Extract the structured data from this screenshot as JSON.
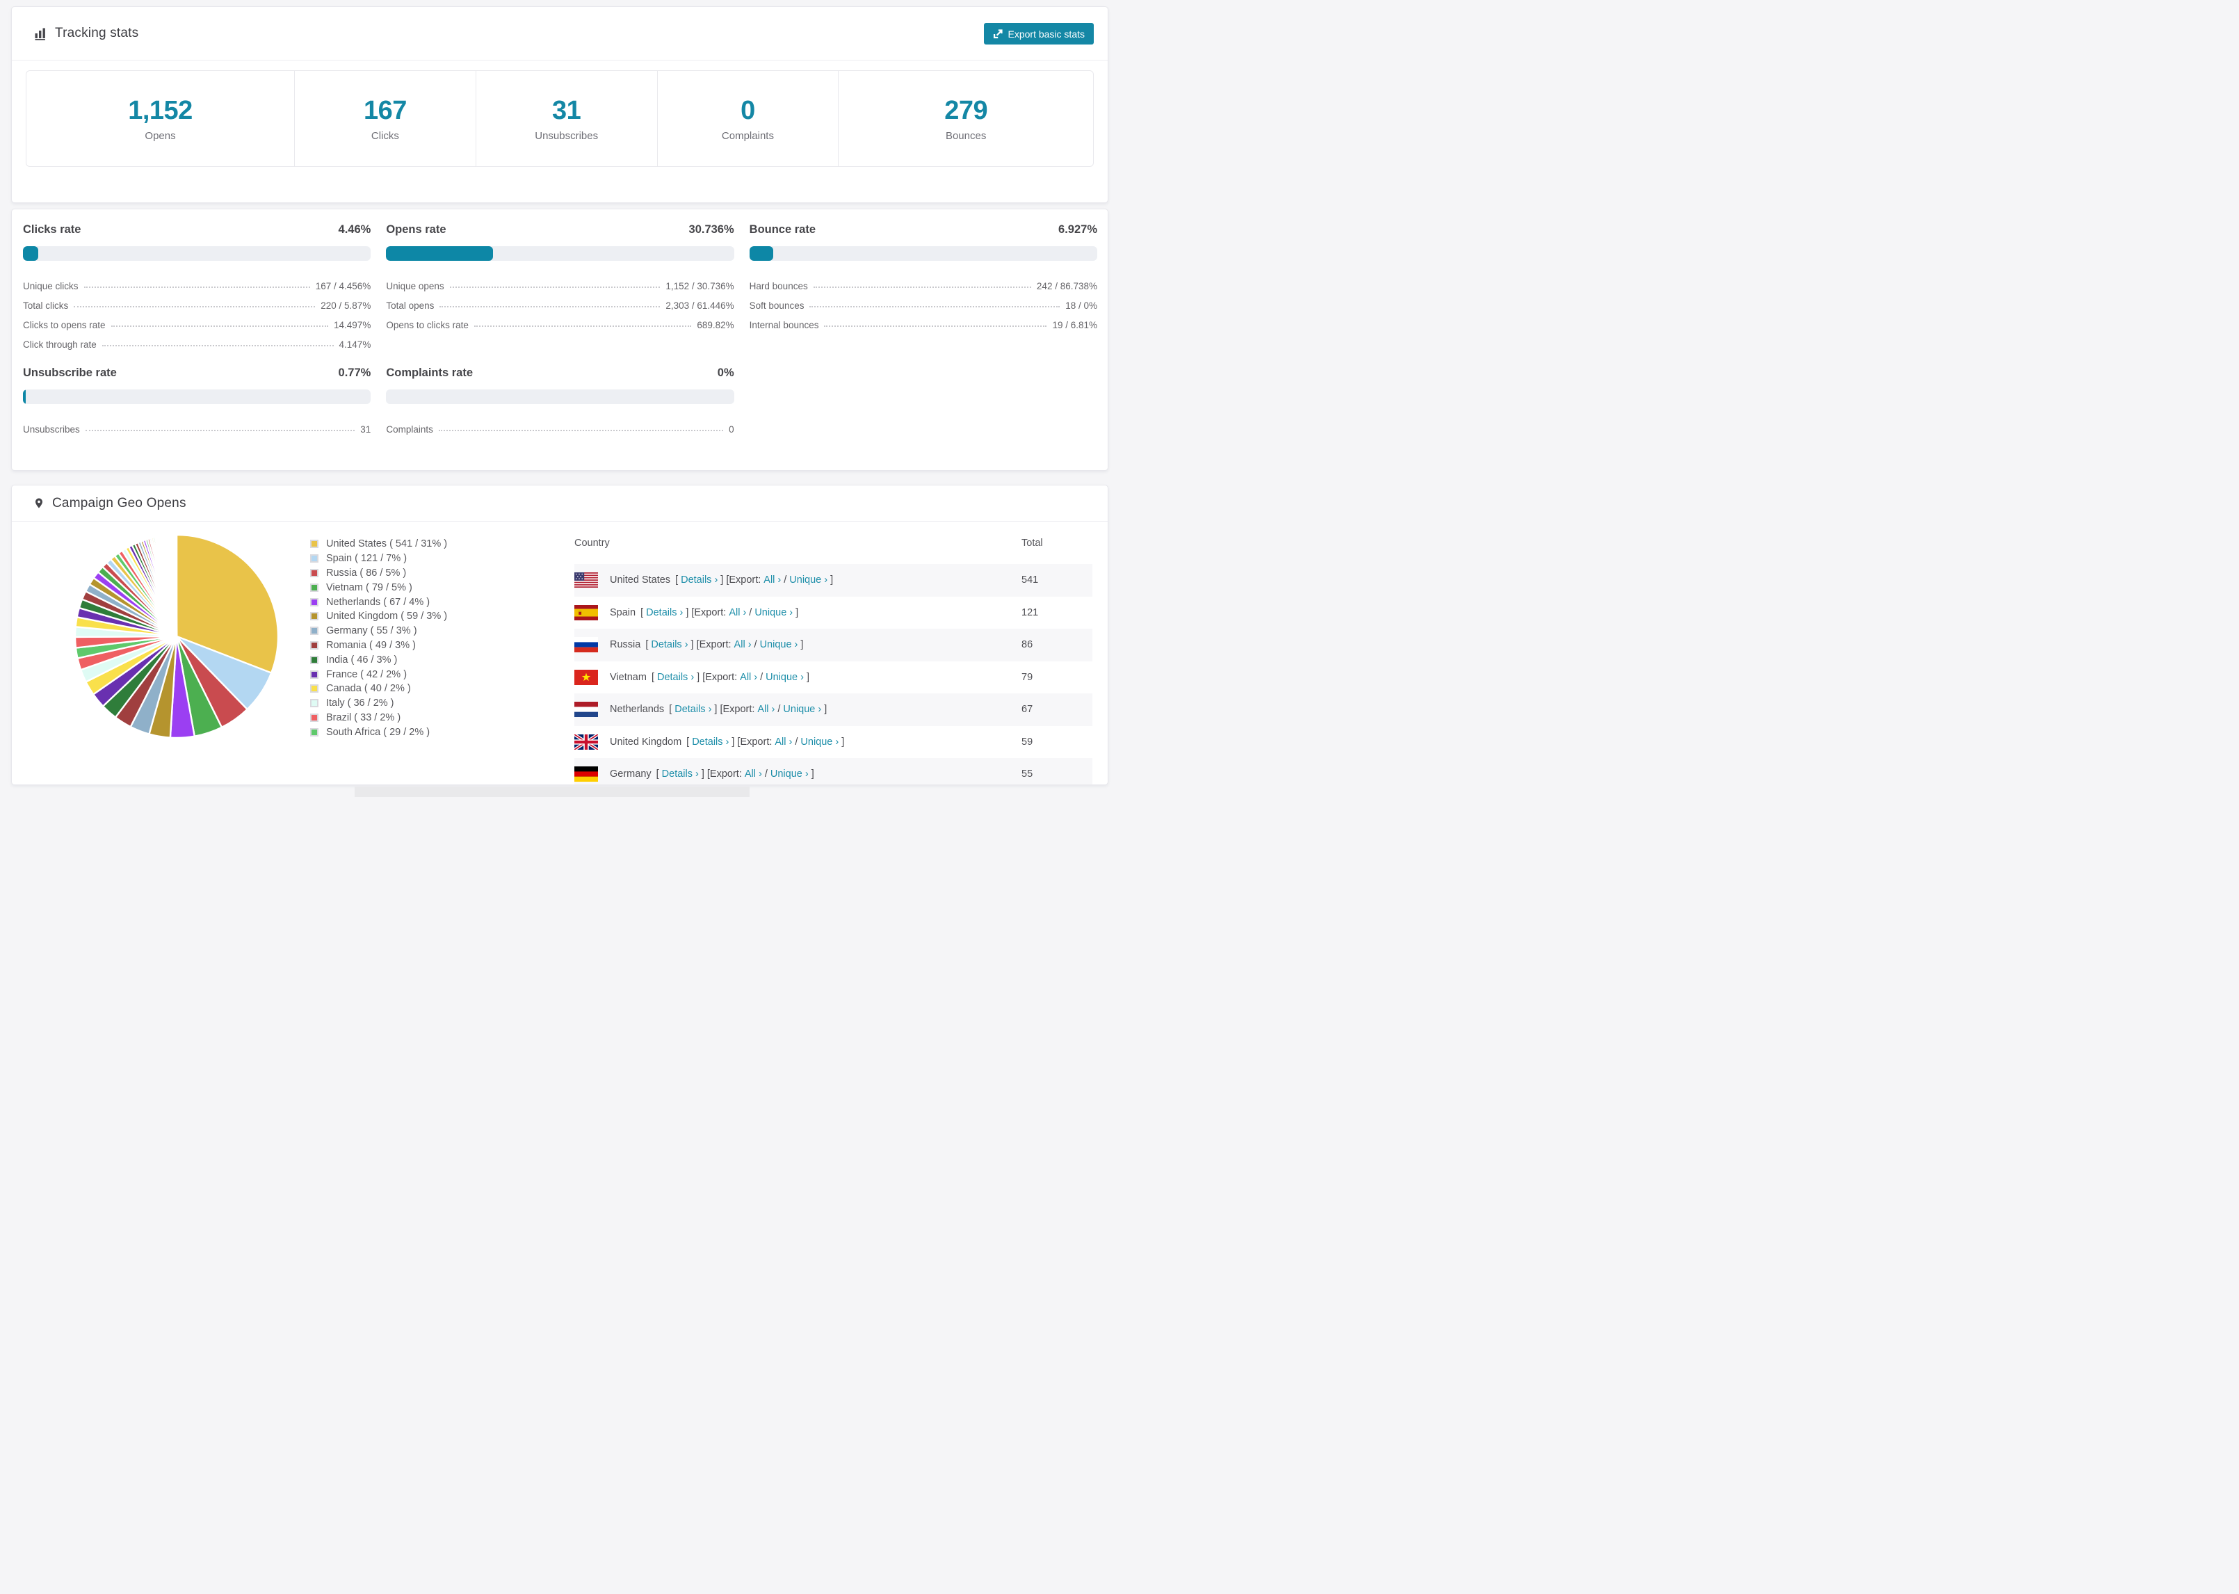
{
  "page": {
    "background": "#f5f5f7",
    "accent": "#1487a5"
  },
  "tracking": {
    "title": "Tracking stats",
    "title_icon": "bar-chart-icon",
    "export_button": {
      "label": "Export basic stats",
      "icon": "export-icon",
      "color": "#1487a5"
    },
    "stats": [
      {
        "value": "1,152",
        "label": "Opens"
      },
      {
        "value": "167",
        "label": "Clicks"
      },
      {
        "value": "31",
        "label": "Unsubscribes"
      },
      {
        "value": "0",
        "label": "Complaints"
      },
      {
        "value": "279",
        "label": "Bounces"
      }
    ]
  },
  "rates": {
    "bar_fill_color": "#0d87a6",
    "bar_track_color": "#edeff3",
    "sections": [
      {
        "id": "clicks-rate",
        "title": "Clicks rate",
        "value": "4.46%",
        "percent": 4.46,
        "rows": [
          {
            "label": "Unique clicks",
            "value": "167 / 4.456%"
          },
          {
            "label": "Total clicks",
            "value": "220 / 5.87%"
          },
          {
            "label": "Clicks to opens rate",
            "value": "14.497%"
          },
          {
            "label": "Click through rate",
            "value": "4.147%"
          }
        ]
      },
      {
        "id": "opens-rate",
        "title": "Opens rate",
        "value": "30.736%",
        "percent": 30.736,
        "rows": [
          {
            "label": "Unique opens",
            "value": "1,152 / 30.736%"
          },
          {
            "label": "Total opens",
            "value": "2,303 / 61.446%"
          },
          {
            "label": "Opens to clicks rate",
            "value": "689.82%"
          }
        ]
      },
      {
        "id": "bounce-rate",
        "title": "Bounce rate",
        "value": "6.927%",
        "percent": 6.927,
        "rows": [
          {
            "label": "Hard bounces",
            "value": "242 / 86.738%"
          },
          {
            "label": "Soft bounces",
            "value": "18 / 0%"
          },
          {
            "label": "Internal bounces",
            "value": "19 / 6.81%"
          }
        ]
      },
      {
        "id": "unsubscribe-rate",
        "title": "Unsubscribe rate",
        "value": "0.77%",
        "percent": 0.77,
        "rows": [
          {
            "label": "Unsubscribes",
            "value": "31"
          }
        ]
      },
      {
        "id": "complaints-rate",
        "title": "Complaints rate",
        "value": "0%",
        "percent": 0,
        "rows": [
          {
            "label": "Complaints",
            "value": "0"
          }
        ]
      }
    ]
  },
  "geo": {
    "title": "Campaign Geo Opens",
    "title_icon": "map-pin-icon",
    "chart_data": {
      "type": "pie",
      "title": "Campaign Geo Opens",
      "legend_position": "right",
      "legend_format": "{label} ( {value} / {pct} )",
      "series": [
        {
          "label": "United States",
          "value": 541,
          "pct": "31%",
          "color": "#e9c349"
        },
        {
          "label": "Spain",
          "value": 121,
          "pct": "7%",
          "color": "#b3d7f2"
        },
        {
          "label": "Russia",
          "value": 86,
          "pct": "5%",
          "color": "#c94b4f"
        },
        {
          "label": "Vietnam",
          "value": 79,
          "pct": "5%",
          "color": "#4caf50"
        },
        {
          "label": "Netherlands",
          "value": 67,
          "pct": "4%",
          "color": "#9b3ff2"
        },
        {
          "label": "United Kingdom",
          "value": 59,
          "pct": "3%",
          "color": "#b5942e"
        },
        {
          "label": "Germany",
          "value": 55,
          "pct": "3%",
          "color": "#8fb0c9"
        },
        {
          "label": "Romania",
          "value": 49,
          "pct": "3%",
          "color": "#a03f3f"
        },
        {
          "label": "India",
          "value": 46,
          "pct": "3%",
          "color": "#2f7d3a"
        },
        {
          "label": "France",
          "value": 42,
          "pct": "2%",
          "color": "#6930b0"
        },
        {
          "label": "Canada",
          "value": 40,
          "pct": "2%",
          "color": "#f9e04b"
        },
        {
          "label": "Italy",
          "value": 36,
          "pct": "2%",
          "color": "#dffbf4"
        },
        {
          "label": "Brazil",
          "value": 33,
          "pct": "2%",
          "color": "#ef5f62"
        },
        {
          "label": "South Africa",
          "value": 29,
          "pct": "2%",
          "color": "#5fc96b"
        }
      ],
      "other_values": [
        30,
        28,
        27,
        26,
        25,
        24,
        22,
        21,
        20,
        19,
        16,
        15,
        14,
        13,
        12,
        11,
        10,
        10,
        9,
        9,
        8,
        7,
        7,
        6,
        6,
        5,
        5,
        5,
        4,
        4,
        4,
        3,
        3,
        3,
        3,
        2,
        2,
        2,
        2,
        2,
        2,
        2,
        2,
        1,
        1,
        1,
        1,
        1,
        1,
        1,
        1,
        1,
        1,
        1,
        1,
        1,
        1,
        1,
        1,
        1,
        1,
        1,
        1
      ]
    },
    "table": {
      "columns": [
        "Country",
        "Total"
      ],
      "link_labels": {
        "bracket_open": "[",
        "details": "Details ›",
        "bracket_close": "]",
        "export_open": "[Export:",
        "all": "All ›",
        "slash": "/",
        "unique": "Unique ›",
        "export_close": "]"
      },
      "rows": [
        {
          "country": "United States",
          "flag": "us",
          "total": "541"
        },
        {
          "country": "Spain",
          "flag": "es",
          "total": "121"
        },
        {
          "country": "Russia",
          "flag": "ru",
          "total": "86"
        },
        {
          "country": "Vietnam",
          "flag": "vn",
          "total": "79"
        },
        {
          "country": "Netherlands",
          "flag": "nl",
          "total": "67"
        },
        {
          "country": "United Kingdom",
          "flag": "gb",
          "total": "59"
        },
        {
          "country": "Germany",
          "flag": "de",
          "total": "55"
        }
      ]
    }
  }
}
